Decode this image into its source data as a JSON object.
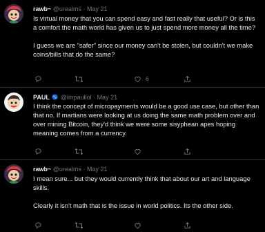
{
  "colors": {
    "background": "#000000",
    "text": "#e7e9ea",
    "muted": "#71767b",
    "divider": "#2f3336"
  },
  "tweets": [
    {
      "display_name": "rawb~",
      "handle": "@urealms",
      "separator": "·",
      "date": "May 21",
      "avatar_icon": "cartoon-avatar-icon",
      "paragraphs": [
        "Is virtual money that you can spend easy and fast really that useful? Or is this a comfort the math world has given us to just spend more money all the time?",
        "I guess we are \"safer\" since our money can't be stolen, but couldn't we make coins/bills that do the same?"
      ],
      "reply_count": "",
      "retweet_count": "",
      "like_count": "6",
      "share_count": ""
    },
    {
      "display_name": "PAUL",
      "handle": "@lmpaullol",
      "separator": "·",
      "date": "May 21",
      "avatar_icon": "cartoon-avatar-icon",
      "badge_icon": "blue-globe-icon",
      "paragraphs": [
        "I think the concept of micropayments would be a good use case, but other than that no. If martians were looking at us doing the same math problem over and over mining Bitcoin, they'd think we were some sisyphean apes hoping meaning comes from a currency."
      ],
      "reply_count": "",
      "retweet_count": "",
      "like_count": "",
      "share_count": ""
    },
    {
      "display_name": "rawb~",
      "handle": "@urealms",
      "separator": "·",
      "date": "May 21",
      "avatar_icon": "cartoon-avatar-icon",
      "paragraphs": [
        "I mean sure... but they would currently think that about our art and language skills.",
        "Clearly it isn't math that is the issue in world politics. Its the other side."
      ],
      "reply_count": "",
      "retweet_count": "",
      "like_count": "",
      "share_count": ""
    }
  ],
  "action_icons": {
    "reply": "reply-icon",
    "retweet": "retweet-icon",
    "like": "heart-icon",
    "share": "share-icon"
  }
}
